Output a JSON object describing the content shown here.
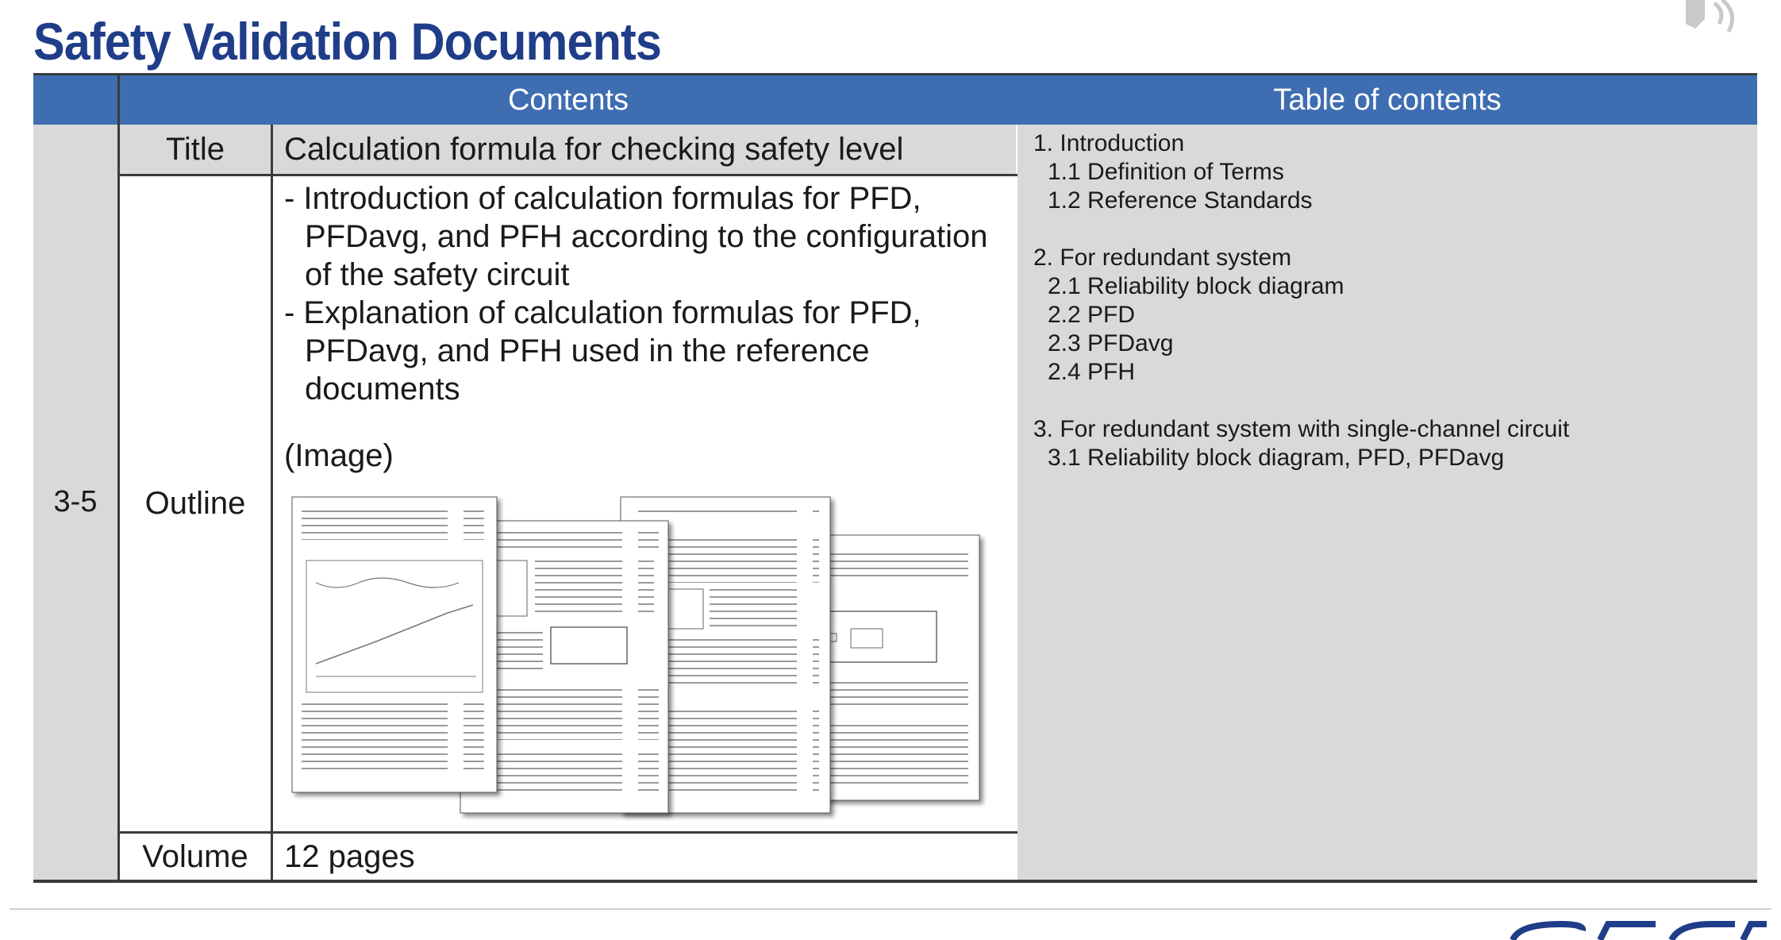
{
  "slide": {
    "title": "Safety Validation Documents"
  },
  "table": {
    "header_contents": "Contents",
    "header_toc": "Table of contents",
    "row_id": "3-5",
    "labels": {
      "title": "Title",
      "outline": "Outline",
      "volume": "Volume"
    },
    "title_value": "Calculation formula for checking safety level",
    "outline_items": [
      "- Introduction of calculation formulas for PFD, PFDavg, and PFH according to the configuration of the safety circuit",
      "- Explanation of calculation formulas for PFD, PFDavg, and PFH used in the reference documents"
    ],
    "image_label": "(Image)",
    "volume_value": "12 pages"
  },
  "toc": [
    {
      "text": "1. Introduction",
      "level": 1
    },
    {
      "text": "1.1  Definition of Terms",
      "level": 2
    },
    {
      "text": "1.2  Reference Standards",
      "level": 2
    },
    {
      "text": "2. For redundant system",
      "level": 1
    },
    {
      "text": "2.1  Reliability block diagram",
      "level": 2
    },
    {
      "text": "2.2  PFD",
      "level": 2
    },
    {
      "text": "2.3  PFDavg",
      "level": 2
    },
    {
      "text": "2.4  PFH",
      "level": 2
    },
    {
      "text": "3. For redundant system with single-channel circuit",
      "level": 1
    },
    {
      "text": "3.1  Reliability block diagram, PFD, PFDavg",
      "level": 2
    }
  ],
  "icons": {
    "speaker": "speaker-icon",
    "logo": "renesas-logo"
  },
  "colors": {
    "title": "#1f3d88",
    "header_band": "#3e6db1",
    "cell_gray": "#d9d9d9"
  }
}
